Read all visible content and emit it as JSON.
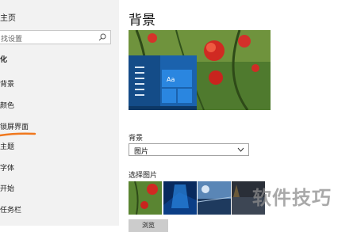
{
  "sidebar": {
    "home_label": "主页",
    "search_placeholder": "找设置",
    "section_title": "化",
    "items": [
      {
        "label": "背景"
      },
      {
        "label": "颜色"
      },
      {
        "label": "锁屏界面"
      },
      {
        "label": "主题"
      },
      {
        "label": "字体"
      },
      {
        "label": "开始"
      },
      {
        "label": "任务栏"
      }
    ],
    "highlight_color": "#f0781e"
  },
  "main": {
    "title": "背景",
    "preview_sample_text": "Aa",
    "background_label": "背景",
    "background_value": "图片",
    "choose_label": "选择图片",
    "browse_label": "浏览"
  },
  "watermark": "软件技巧",
  "colors": {
    "accent": "#1e73c8",
    "sidebar_bg": "#f2f2f2"
  }
}
